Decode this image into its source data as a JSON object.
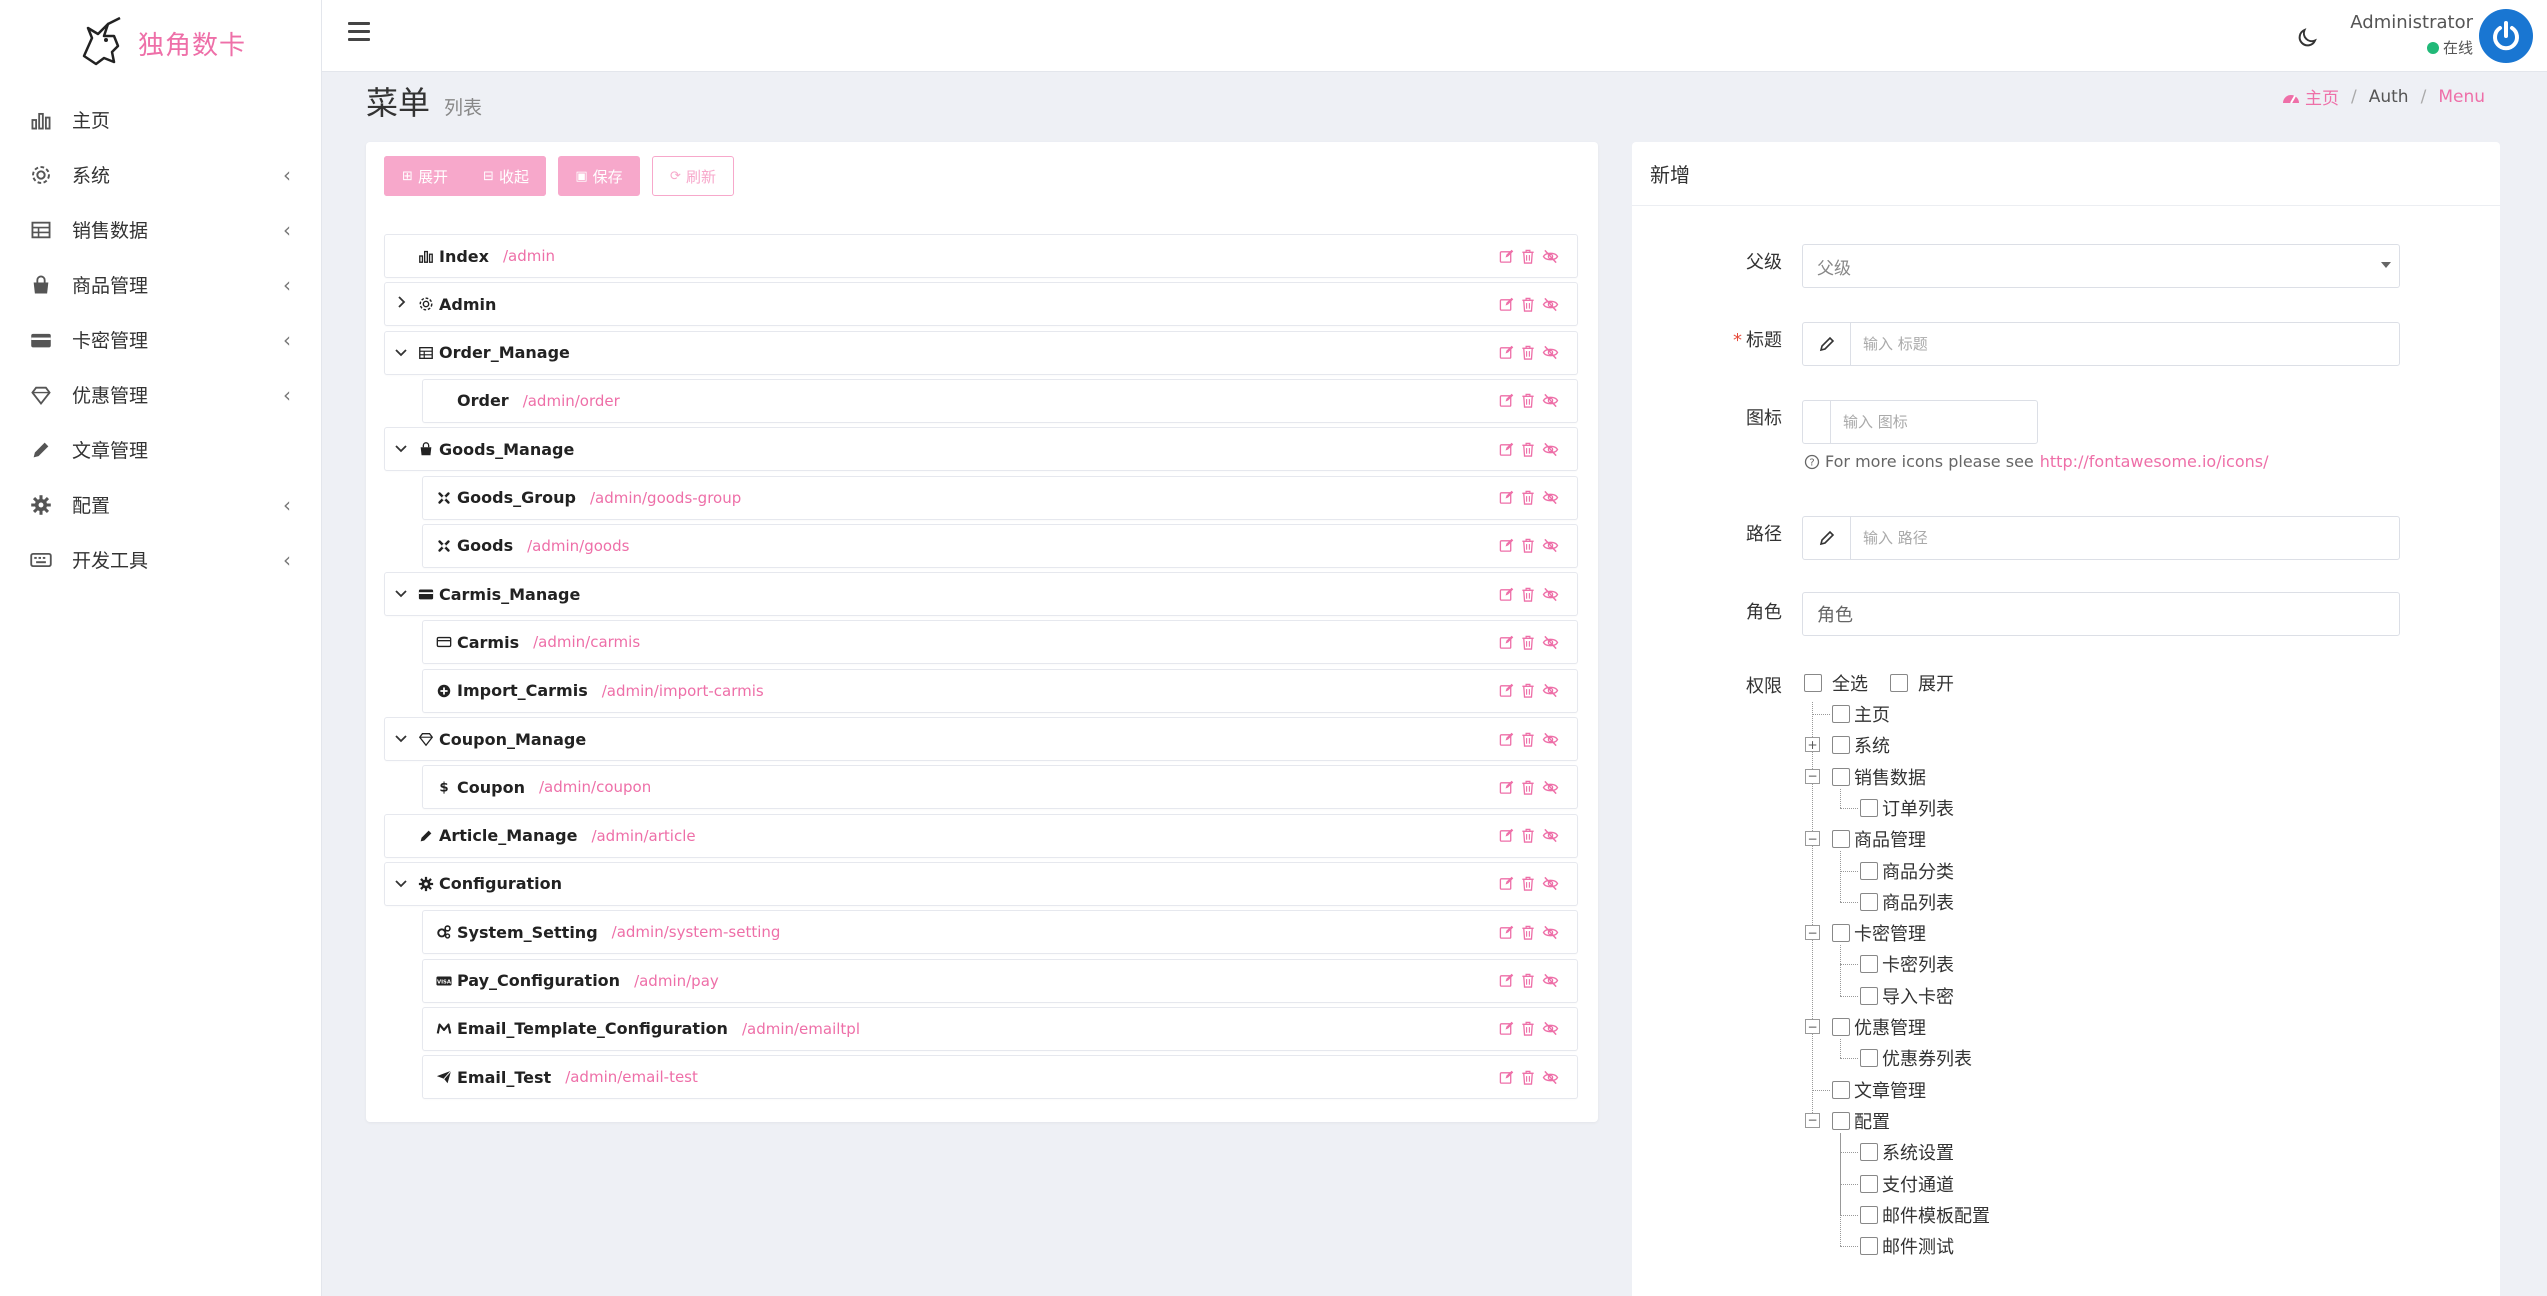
{
  "brand": {
    "name": "独角数卡"
  },
  "sidebar": {
    "items": [
      {
        "label": "主页",
        "icon": "bar-chart-icon",
        "submenu": false
      },
      {
        "label": "系统",
        "icon": "gear-icon",
        "submenu": true
      },
      {
        "label": "销售数据",
        "icon": "table-icon",
        "submenu": true
      },
      {
        "label": "商品管理",
        "icon": "shopping-bag-icon",
        "submenu": true
      },
      {
        "label": "卡密管理",
        "icon": "credit-card-icon",
        "submenu": true
      },
      {
        "label": "优惠管理",
        "icon": "diamond-icon",
        "submenu": true
      },
      {
        "label": "文章管理",
        "icon": "pencil-icon",
        "submenu": false
      },
      {
        "label": "配置",
        "icon": "cog-icon",
        "submenu": true
      },
      {
        "label": "开发工具",
        "icon": "keyboard-icon",
        "submenu": true
      }
    ]
  },
  "header": {
    "user_name": "Administrator",
    "user_status": "在线"
  },
  "page": {
    "title": "菜单",
    "subtitle": "列表",
    "breadcrumb": {
      "home": "主页",
      "auth": "Auth",
      "menu": "Menu"
    }
  },
  "toolbar": {
    "expand": "展开",
    "collapse": "收起",
    "save": "保存",
    "refresh": "刷新"
  },
  "menu_tree": [
    {
      "title": "Index",
      "path": "/admin",
      "icon": "bar-chart-icon",
      "level": 0,
      "toggle": ""
    },
    {
      "title": "Admin",
      "path": "",
      "icon": "gear-icon",
      "level": 0,
      "toggle": "›"
    },
    {
      "title": "Order_Manage",
      "path": "",
      "icon": "table-icon",
      "level": 0,
      "toggle": "⌄"
    },
    {
      "title": "Order",
      "path": "/admin/order",
      "icon": "apple-icon",
      "level": 1,
      "toggle": ""
    },
    {
      "title": "Goods_Manage",
      "path": "",
      "icon": "shopping-bag-icon",
      "level": 0,
      "toggle": "⌄"
    },
    {
      "title": "Goods_Group",
      "path": "/admin/goods-group",
      "icon": "joomla-icon",
      "level": 1,
      "toggle": ""
    },
    {
      "title": "Goods",
      "path": "/admin/goods",
      "icon": "joomla-icon",
      "level": 1,
      "toggle": ""
    },
    {
      "title": "Carmis_Manage",
      "path": "",
      "icon": "credit-card-icon",
      "level": 0,
      "toggle": "⌄"
    },
    {
      "title": "Carmis",
      "path": "/admin/carmis",
      "icon": "credit-card-outline-icon",
      "level": 1,
      "toggle": ""
    },
    {
      "title": "Import_Carmis",
      "path": "/admin/import-carmis",
      "icon": "plus-circle-icon",
      "level": 1,
      "toggle": ""
    },
    {
      "title": "Coupon_Manage",
      "path": "",
      "icon": "diamond-icon",
      "level": 0,
      "toggle": "⌄"
    },
    {
      "title": "Coupon",
      "path": "/admin/coupon",
      "icon": "dollar-icon",
      "level": 1,
      "toggle": ""
    },
    {
      "title": "Article_Manage",
      "path": "/admin/article",
      "icon": "pencil-icon",
      "level": 0,
      "toggle": ""
    },
    {
      "title": "Configuration",
      "path": "",
      "icon": "cog-icon",
      "level": 0,
      "toggle": "⌄"
    },
    {
      "title": "System_Setting",
      "path": "/admin/system-setting",
      "icon": "cogs-icon",
      "level": 1,
      "toggle": ""
    },
    {
      "title": "Pay_Configuration",
      "path": "/admin/pay",
      "icon": "visa-icon",
      "level": 1,
      "toggle": ""
    },
    {
      "title": "Email_Template_Configuration",
      "path": "/admin/emailtpl",
      "icon": "mailchimp-icon",
      "level": 1,
      "toggle": ""
    },
    {
      "title": "Email_Test",
      "path": "/admin/email-test",
      "icon": "paper-plane-icon",
      "level": 1,
      "toggle": ""
    }
  ],
  "form": {
    "heading": "新增",
    "parent_label": "父级",
    "parent_value": "父级",
    "title_label": "标题",
    "title_placeholder": "输入 标题",
    "icon_label": "图标",
    "icon_placeholder": "输入 图标",
    "help_text": "For more icons please see",
    "help_link": "http://fontawesome.io/icons/",
    "path_label": "路径",
    "path_placeholder": "输入 路径",
    "role_label": "角色",
    "role_value": "角色",
    "perm_label": "权限",
    "select_all": "全选",
    "expand_all": "展开"
  },
  "permissions": [
    {
      "label": "主页",
      "level": 0,
      "box": ""
    },
    {
      "label": "系统",
      "level": 0,
      "box": "+"
    },
    {
      "label": "销售数据",
      "level": 0,
      "box": "−"
    },
    {
      "label": "订单列表",
      "level": 1,
      "box": ""
    },
    {
      "label": "商品管理",
      "level": 0,
      "box": "−"
    },
    {
      "label": "商品分类",
      "level": 1,
      "box": ""
    },
    {
      "label": "商品列表",
      "level": 1,
      "box": ""
    },
    {
      "label": "卡密管理",
      "level": 0,
      "box": "−"
    },
    {
      "label": "卡密列表",
      "level": 1,
      "box": ""
    },
    {
      "label": "导入卡密",
      "level": 1,
      "box": ""
    },
    {
      "label": "优惠管理",
      "level": 0,
      "box": "−"
    },
    {
      "label": "优惠券列表",
      "level": 1,
      "box": ""
    },
    {
      "label": "文章管理",
      "level": 0,
      "box": ""
    },
    {
      "label": "配置",
      "level": 0,
      "box": "−"
    },
    {
      "label": "系统设置",
      "level": 1,
      "box": ""
    },
    {
      "label": "支付通道",
      "level": 1,
      "box": ""
    },
    {
      "label": "邮件模板配置",
      "level": 1,
      "box": ""
    },
    {
      "label": "邮件测试",
      "level": 1,
      "box": ""
    }
  ],
  "colors": {
    "accent": "#ee6fa8",
    "button_bg": "#f7a8cb",
    "online": "#21b978",
    "avatar": "#1976d2"
  }
}
